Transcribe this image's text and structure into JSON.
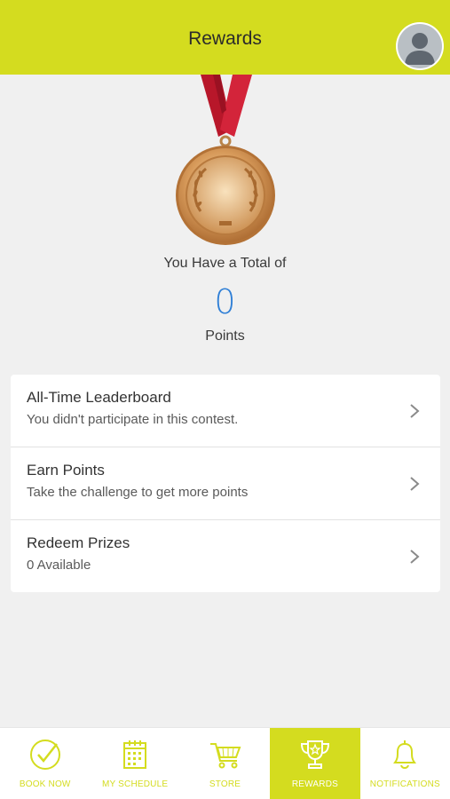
{
  "header": {
    "title": "Rewards"
  },
  "summary": {
    "total_label": "You Have a Total of",
    "points": "0",
    "points_label": "Points"
  },
  "menu": [
    {
      "title": "All-Time Leaderboard",
      "subtitle": "You didn't participate in this contest."
    },
    {
      "title": "Earn Points",
      "subtitle": "Take the challenge to get more points"
    },
    {
      "title": "Redeem Prizes",
      "subtitle": "0 Available"
    }
  ],
  "tabs": [
    {
      "label": "BOOK NOW",
      "icon": "check-circle-icon"
    },
    {
      "label": "MY SCHEDULE",
      "icon": "calendar-icon"
    },
    {
      "label": "STORE",
      "icon": "cart-icon"
    },
    {
      "label": "REWARDS",
      "icon": "trophy-icon",
      "active": true
    },
    {
      "label": "NOTIFICATIONS",
      "icon": "bell-icon"
    }
  ],
  "colors": {
    "accent": "#d4dc1f",
    "points": "#2f7fd6",
    "ribbon": "#c0192c",
    "medal": "#c98a4a"
  }
}
